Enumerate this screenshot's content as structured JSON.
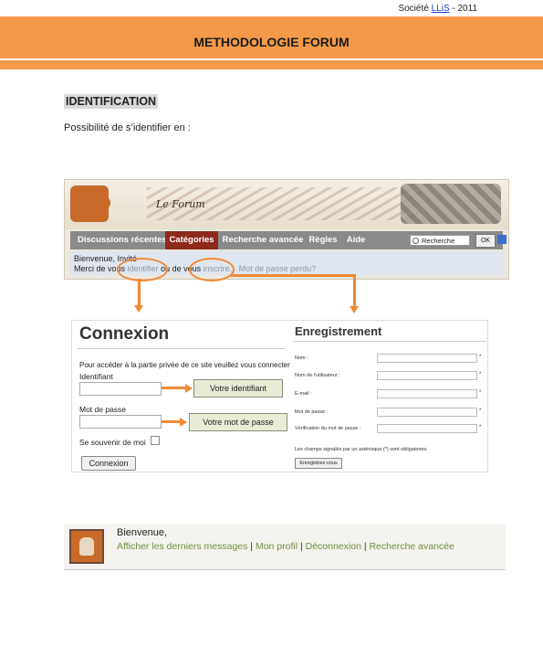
{
  "header": {
    "company_prefix": "Société ",
    "company_link": "LLiS",
    "company_suffix": " - 2011"
  },
  "banner": {
    "title": "METHODOLOGIE FORUM"
  },
  "section": {
    "title": "IDENTIFICATION",
    "intro": "Possibilité de s’identifier en :"
  },
  "forum": {
    "logo": "Le Forum",
    "nav": [
      "Discussions récentes",
      "Catégories",
      "Recherche avancée",
      "Règles",
      "Aide"
    ],
    "search_value": "Recherche",
    "ok_label": "OK",
    "welcome_line1": "Bienvenue, Invité",
    "welcome_prefix": "Merci de vous ",
    "link_identifier": "identifier",
    "welcome_mid": " ou de vous ",
    "link_inscrire": "inscrire.",
    "link_password": "Mot de passe perdu?"
  },
  "connexion": {
    "title": "Connexion",
    "description": "Pour accéder à la partie privée de ce site veuillez vous connecter",
    "id_label": "Identifiant",
    "pwd_label": "Mot de passe",
    "remember_label": "Se souvenir de moi",
    "button": "Connexion",
    "callout_id": "Votre identifiant",
    "callout_pwd": "Votre mot de passe"
  },
  "registration": {
    "title": "Enregistrement",
    "fields": [
      "Nom :",
      "Nom de l'utilisateur :",
      "E-mail :",
      "Mot de passe :",
      "Vérification du mot de passe :"
    ],
    "required_mark": "*",
    "note": "Les champs signalés par un astérisque (*) sont obligatoires.",
    "button": "Enregistrez-vous"
  },
  "loggedin": {
    "welcome": "Bienvenue,",
    "link1": "Afficher les derniers messages",
    "sep": " | ",
    "link2": "Mon profil",
    "link3": "Déconnexion",
    "link4": "Recherche avancée"
  },
  "colors": {
    "banner": "#f39a4a",
    "arrow": "#f08a35",
    "active_tab": "#8e2a1a",
    "callout_bg": "#e7ecd7"
  }
}
